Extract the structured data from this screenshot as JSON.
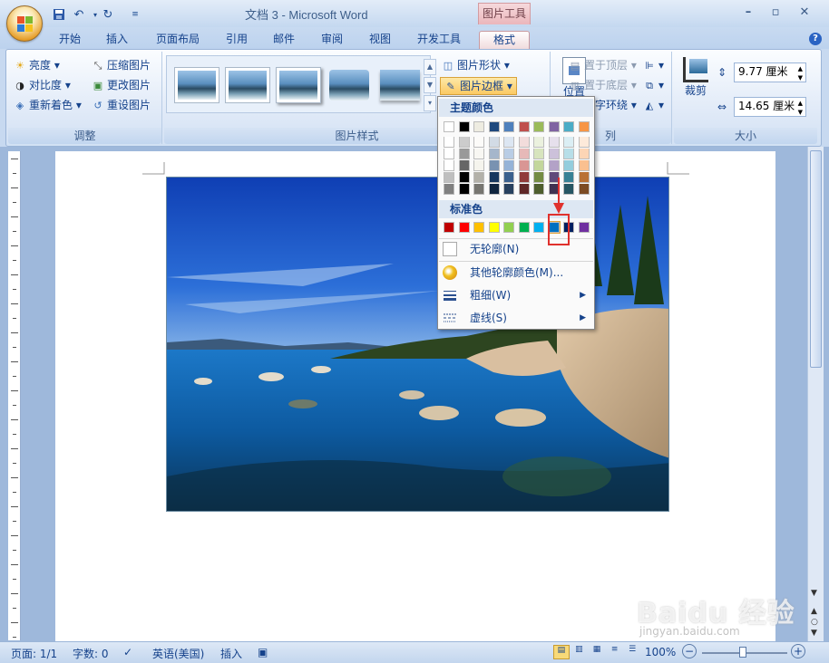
{
  "window": {
    "title": "文档 3 - Microsoft Word",
    "contextual_tab": "图片工具"
  },
  "tabs": [
    "开始",
    "插入",
    "页面布局",
    "引用",
    "邮件",
    "审阅",
    "视图",
    "开发工具",
    "格式"
  ],
  "ribbon": {
    "adjust": {
      "brightness": "亮度",
      "contrast": "对比度",
      "recolor": "重新着色",
      "compress": "压缩图片",
      "change": "更改图片",
      "reset": "重设图片",
      "title": "调整"
    },
    "styles": {
      "title": "图片样式",
      "shape": "图片形状",
      "border": "图片边框"
    },
    "arrange": {
      "position": "位置",
      "front": "置于顶层",
      "back": "置于底层",
      "wrap": "文字环绕",
      "title_suffix": "列"
    },
    "size": {
      "crop": "裁剪",
      "height": "9.77 厘米",
      "width": "14.65 厘米",
      "title": "大小"
    }
  },
  "menu": {
    "theme_header": "主题颜色",
    "standard_header": "标准色",
    "no_outline": "无轮廓(N)",
    "more_colors": "其他轮廓颜色(M)...",
    "weight": "粗细(W)",
    "dashes": "虚线(S)",
    "theme_colors": [
      "#ffffff",
      "#000000",
      "#eeece1",
      "#1f497d",
      "#4f81bd",
      "#c0504d",
      "#9bbb59",
      "#8064a2",
      "#4bacc6",
      "#f79646"
    ],
    "standard_colors": [
      "#c00000",
      "#ff0000",
      "#ffc000",
      "#ffff00",
      "#92d050",
      "#00b050",
      "#00b0f0",
      "#0070c0",
      "#002060",
      "#7030a0"
    ]
  },
  "status": {
    "page": "页面: 1/1",
    "words": "字数: 0",
    "language": "英语(美国)",
    "mode": "插入",
    "zoom": "100%"
  },
  "watermark": {
    "main": "Baidu 经验",
    "sub": "jingyan.baidu.com"
  }
}
